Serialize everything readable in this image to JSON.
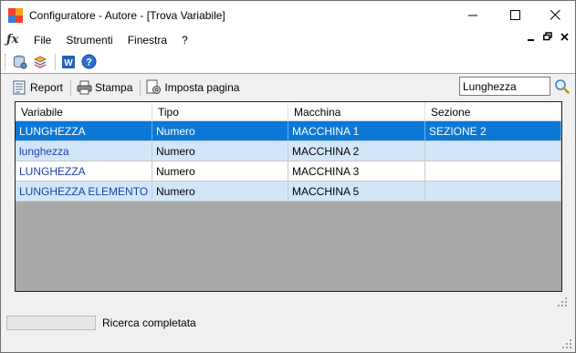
{
  "window": {
    "title": "Configuratore - Autore - [Trova Variabile]",
    "controls": {
      "minimize": "—",
      "maximize": "☐",
      "close": "✕"
    }
  },
  "menubar": {
    "items": [
      "File",
      "Strumenti",
      "Finestra",
      "?"
    ],
    "mdi_controls": {
      "minimize": "_",
      "restore": "🗗",
      "close": "✕"
    }
  },
  "toolbar": {
    "icons": [
      "database-config-icon",
      "layers-icon",
      "word-document-icon",
      "help-icon"
    ]
  },
  "report_toolbar": {
    "report_label": "Report",
    "print_label": "Stampa",
    "page_setup_label": "Imposta pagina",
    "search_value": "Lunghezza"
  },
  "table": {
    "columns": [
      "Variabile",
      "Tipo",
      "Macchina",
      "Sezione"
    ],
    "rows": [
      [
        "LUNGHEZZA",
        "Numero",
        "MACCHINA 1",
        "SEZIONE 2"
      ],
      [
        "lunghezza",
        "Numero",
        "MACCHINA 2",
        ""
      ],
      [
        "LUNGHEZZA",
        "Numero",
        "MACCHINA 3",
        ""
      ],
      [
        "LUNGHEZZA ELEMENTO",
        "Numero",
        "MACCHINA 5",
        ""
      ]
    ],
    "selected_row": 0
  },
  "status": {
    "text": "Ricerca completata"
  },
  "colors": {
    "selection": "#0a78d7",
    "alt_row": "#d2e6fa",
    "grid_background": "#a9a9a9",
    "variable_text": "#1d3fa5"
  }
}
